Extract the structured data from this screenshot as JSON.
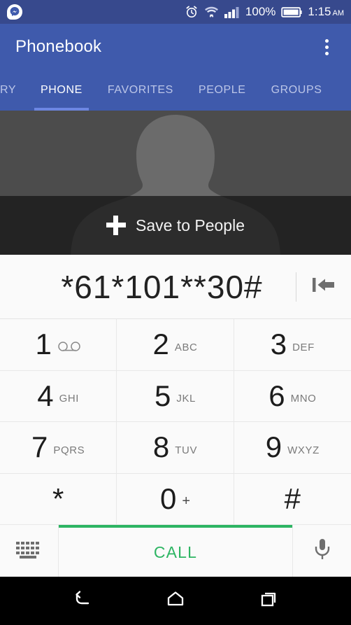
{
  "status_bar": {
    "notification_icon": "messenger-icon",
    "icons": [
      "alarm-icon",
      "wifi-icon",
      "signal-icon"
    ],
    "battery_percent": "100%",
    "battery_icon": "battery-full-icon",
    "time": "1:15",
    "ampm": "AM",
    "background_color": "#37498d"
  },
  "app_bar": {
    "title": "Phonebook",
    "overflow_menu": "overflow-menu-icon",
    "background_color": "#3f5aac"
  },
  "tabs": {
    "active_index": 1,
    "items": [
      {
        "label": "RY"
      },
      {
        "label": "PHONE"
      },
      {
        "label": "FAVORITES"
      },
      {
        "label": "PEOPLE"
      },
      {
        "label": "GROUPS"
      }
    ],
    "indicator_color": "#6c86e2"
  },
  "contact_banner": {
    "avatar": "person-placeholder-icon",
    "save_label": "Save to People",
    "plus_icon": "plus-icon"
  },
  "dialer": {
    "number": "*61*101**30#",
    "backspace_icon": "backspace-icon",
    "keys": [
      {
        "digit": "1",
        "sub": "",
        "icon": "voicemail-icon"
      },
      {
        "digit": "2",
        "sub": "ABC",
        "icon": ""
      },
      {
        "digit": "3",
        "sub": "DEF",
        "icon": ""
      },
      {
        "digit": "4",
        "sub": "GHI",
        "icon": ""
      },
      {
        "digit": "5",
        "sub": "JKL",
        "icon": ""
      },
      {
        "digit": "6",
        "sub": "MNO",
        "icon": ""
      },
      {
        "digit": "7",
        "sub": "PQRS",
        "icon": ""
      },
      {
        "digit": "8",
        "sub": "TUV",
        "icon": ""
      },
      {
        "digit": "9",
        "sub": "WXYZ",
        "icon": ""
      },
      {
        "digit": "*",
        "sub": "",
        "icon": ""
      },
      {
        "digit": "0",
        "sub": "+",
        "icon": ""
      },
      {
        "digit": "#",
        "sub": "",
        "icon": ""
      }
    ]
  },
  "call_bar": {
    "keyboard_icon": "keyboard-icon",
    "call_label": "CALL",
    "call_color": "#2db563",
    "mic_icon": "microphone-icon"
  },
  "nav_bar": {
    "back": "back-icon",
    "home": "home-icon",
    "recents": "recents-icon"
  }
}
